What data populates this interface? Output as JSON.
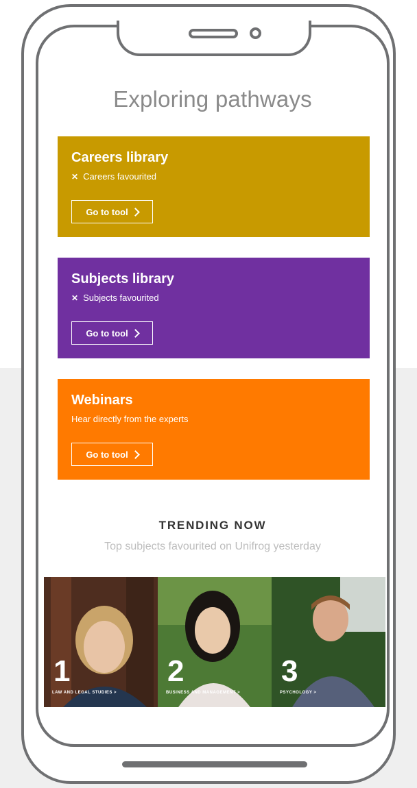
{
  "page": {
    "title": "Exploring pathways"
  },
  "tools": [
    {
      "title": "Careers library",
      "subtitle": "Careers favourited",
      "button": "Go to tool",
      "color": "#c89a00"
    },
    {
      "title": "Subjects library",
      "subtitle": "Subjects favourited",
      "button": "Go to tool",
      "color": "#7030a0"
    },
    {
      "title": "Webinars",
      "subtitle": "Hear directly from the experts",
      "button": "Go to tool",
      "color": "#ff7a00"
    }
  ],
  "trending": {
    "heading": "TRENDING NOW",
    "subheading": "Top subjects favourited on Unifrog yesterday",
    "items": [
      {
        "rank": "1",
        "label": "LAW AND LEGAL STUDIES >"
      },
      {
        "rank": "2",
        "label": "BUSINESS AND MANAGEMENT >"
      },
      {
        "rank": "3",
        "label": "PSYCHOLOGY >"
      }
    ]
  },
  "icons": {
    "favourite_marker": "x-icon",
    "button_arrow": "chevron-right-icon"
  }
}
